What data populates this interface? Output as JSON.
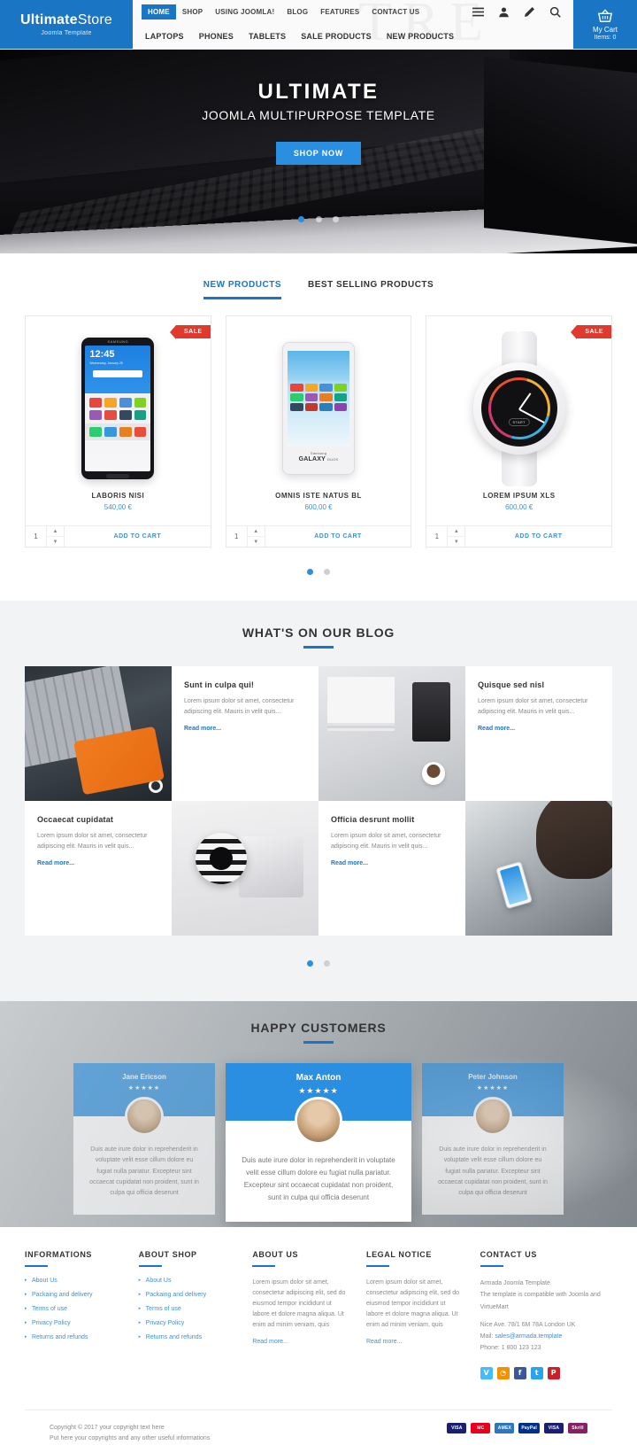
{
  "header": {
    "logo": {
      "bold": "Ultimate",
      "light": "Store",
      "sub": "Joomla Template"
    },
    "ghost_text": "TRE",
    "nav_top": [
      {
        "label": "HOME",
        "active": true
      },
      {
        "label": "SHOP",
        "active": false
      },
      {
        "label": "USING JOOMLA!",
        "active": false
      },
      {
        "label": "BLOG",
        "active": false
      },
      {
        "label": "FEATURES",
        "active": false
      },
      {
        "label": "CONTACT US",
        "active": false
      }
    ],
    "icons": [
      "menu-icon",
      "user-icon",
      "pencil-icon",
      "search-icon"
    ],
    "nav_bottom": [
      "LAPTOPS",
      "PHONES",
      "TABLETS",
      "SALE PRODUCTS",
      "NEW PRODUCTS"
    ],
    "cart": {
      "label": "My Cart",
      "items": "Items: 0"
    }
  },
  "hero": {
    "title": "ULTIMATE",
    "subtitle": "JOOMLA MULTIPURPOSE TEMPLATE",
    "button": "SHOP NOW",
    "slides": 3,
    "active_slide": 1
  },
  "products": {
    "tabs": [
      {
        "label": "NEW PRODUCTS",
        "active": true
      },
      {
        "label": "BEST SELLING PRODUCTS",
        "active": false
      }
    ],
    "sale_badge": "SALE",
    "add_to_cart": "ADD TO CART",
    "qty_value": "1",
    "items": [
      {
        "name": "LABORIS NISI",
        "price": "540,00 €",
        "sale": true,
        "phone_time": "12:45",
        "phone_date": "Wednesday, January 25",
        "phone_brand": "SAMSUNG"
      },
      {
        "name": "OMNIS ISTE NATUS BL",
        "price": "600,00 €",
        "sale": false,
        "device_brand": "Samsung",
        "device_model": "GALAXY",
        "device_sub": "DUOS"
      },
      {
        "name": "LOREM IPSUM XLS",
        "price": "600,00 €",
        "sale": true,
        "watch_label": "START"
      }
    ],
    "dots": 2,
    "active_dot": 1
  },
  "blog": {
    "title": "WHAT'S ON OUR BLOG",
    "read_more": "Read more...",
    "excerpt": "Lorem ipsum dolor sit amet, consectetur adipiscing elit. Mauris in velit quis...",
    "posts": [
      {
        "title": "Sunt in culpa qui!",
        "image": "headphones-keyboard-photo"
      },
      {
        "title": "Quisque sed nisl",
        "image": "desk-coffee-tablet-photo"
      },
      {
        "title": "Occaecat cupidatat",
        "image": "camera-lens-photo"
      },
      {
        "title": "Officia desrunt mollit",
        "image": "woman-phone-photo"
      }
    ],
    "dots": 2,
    "active_dot": 1
  },
  "testimonials": {
    "title": "HAPPY CUSTOMERS",
    "text": "Duis aute irure dolor in reprehenderit in voluptate velit esse cillum dolore eu fugiat nulla pariatur. Excepteur sint occaecat cupidatat non proident, sunt in culpa qui officia deserunt",
    "stars": "★★★★★",
    "items": [
      {
        "name": "Jane Ericson",
        "featured": false
      },
      {
        "name": "Max Anton",
        "featured": true
      },
      {
        "name": "Peter Johnson",
        "featured": false
      }
    ]
  },
  "footer": {
    "col1": {
      "title": "INFORMATIONS",
      "links": [
        "About Us",
        "Packaing and delivery",
        "Terms of use",
        "Privacy Policy",
        "Returns and refunds"
      ]
    },
    "col2": {
      "title": "ABOUT SHOP",
      "links": [
        "About Us",
        "Packaing and delivery",
        "Terms of use",
        "Privacy Policy",
        "Returns and refunds"
      ]
    },
    "col3": {
      "title": "ABOUT US",
      "text": "Lorem ipsum dolor sit amet, consectetur adipiscing elit, sed do eiusmod tempor incididunt ut labore et dolore magna aliqua. Ut enim ad minim veniam, quis",
      "more": "Read more..."
    },
    "col4": {
      "title": "LEGAL NOTICE",
      "text": "Lorem ipsum dolor sit amet, consectetur adipiscing elit, sed do eiusmod tempor incididunt ut labore et dolore magna aliqua. Ut enim ad minim veniam, quis",
      "more": "Read more..."
    },
    "col5": {
      "title": "CONTACT US",
      "line1": "Armada Joomla Template",
      "line2": "The template is compatible with Joomla and VirtueMart",
      "address": "Nice Ave. 78/1 6M 78A London UK",
      "mail_label": "Mail:",
      "mail": "sales@armada.template",
      "phone": "Phone: 1 800 123 123",
      "social": [
        {
          "name": "vimeo-icon",
          "glyph": "V",
          "color": "#45bbff"
        },
        {
          "name": "rss-icon",
          "glyph": "◔",
          "color": "#f39200"
        },
        {
          "name": "facebook-icon",
          "glyph": "f",
          "color": "#3b5998"
        },
        {
          "name": "twitter-icon",
          "glyph": "t",
          "color": "#2aa3ef"
        },
        {
          "name": "pinterest-icon",
          "glyph": "P",
          "color": "#cb2027"
        }
      ]
    },
    "copyright_line1": "Copyright © 2017 your copyright text here",
    "copyright_line2": "Put here your copyrights and any other useful informations",
    "payments": [
      {
        "label": "VISA",
        "bg": "#1a1f71"
      },
      {
        "label": "MC",
        "bg": "#eb001b"
      },
      {
        "label": "AMEX",
        "bg": "#2e77bc"
      },
      {
        "label": "PayPal",
        "bg": "#003087"
      },
      {
        "label": "VISA",
        "bg": "#1a1f71"
      },
      {
        "label": "Skrill",
        "bg": "#862165"
      }
    ]
  }
}
